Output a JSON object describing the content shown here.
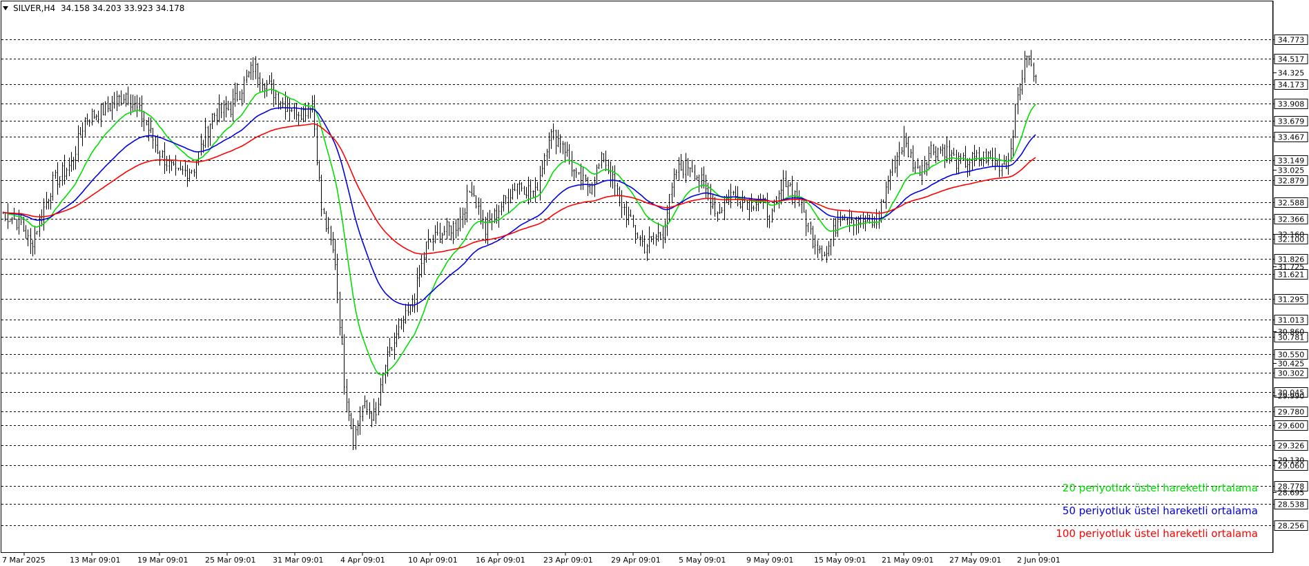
{
  "chart_data": {
    "type": "candlestick",
    "symbol_line": {
      "symbol": "SILVER,H4",
      "values": "34.158 34.203 33.923 34.178"
    },
    "ylim": [
      28.05,
      34.92
    ],
    "tagged_levels": [
      34.773,
      34.517,
      34.173,
      33.908,
      33.679,
      33.467,
      33.149,
      32.879,
      32.588,
      32.366,
      32.1,
      31.826,
      31.621,
      31.295,
      31.013,
      30.781,
      30.55,
      30.302,
      30.045,
      29.78,
      29.6,
      29.326,
      29.06,
      28.778,
      28.538,
      28.256
    ],
    "scale_ticks": [
      34.325,
      33.025,
      32.16,
      31.725,
      30.86,
      30.425,
      29.99,
      29.13,
      28.695
    ],
    "x_labels": [
      "7 Mar 2025",
      "13 Mar 09:01",
      "19 Mar 09:01",
      "25 Mar 09:01",
      "31 Mar 09:01",
      "4 Apr 09:01",
      "10 Apr 09:01",
      "16 Apr 09:01",
      "23 Apr 09:01",
      "29 Apr 09:01",
      "5 May 09:01",
      "9 May 09:01",
      "15 May 09:01",
      "21 May 09:01",
      "27 May 09:01",
      "2 Jun 09:01"
    ],
    "series": [
      {
        "name": "20 periyotluk üstel hareketli ortalama",
        "color": "#00e000",
        "period": 20
      },
      {
        "name": "50 periyotluk üstel hareketli ortalama",
        "color": "#0000e0",
        "period": 50
      },
      {
        "name": "100 periyotluk üstel hareketli ortalama",
        "color": "#ff0000",
        "period": 100
      }
    ],
    "price_path": [
      {
        "t": 0,
        "p": 32.45
      },
      {
        "t": 8,
        "p": 32.3
      },
      {
        "t": 12,
        "p": 32.0
      },
      {
        "t": 22,
        "p": 32.85
      },
      {
        "t": 30,
        "p": 33.1
      },
      {
        "t": 36,
        "p": 33.7
      },
      {
        "t": 46,
        "p": 33.85
      },
      {
        "t": 54,
        "p": 34.05
      },
      {
        "t": 62,
        "p": 33.7
      },
      {
        "t": 68,
        "p": 33.3
      },
      {
        "t": 76,
        "p": 32.95
      },
      {
        "t": 84,
        "p": 33.05
      },
      {
        "t": 92,
        "p": 33.75
      },
      {
        "t": 100,
        "p": 33.85
      },
      {
        "t": 110,
        "p": 34.4
      },
      {
        "t": 118,
        "p": 34.1
      },
      {
        "t": 124,
        "p": 33.9
      },
      {
        "t": 132,
        "p": 33.8
      },
      {
        "t": 136,
        "p": 33.95
      },
      {
        "t": 140,
        "p": 32.5
      },
      {
        "t": 146,
        "p": 31.8
      },
      {
        "t": 150,
        "p": 30.2
      },
      {
        "t": 154,
        "p": 29.4
      },
      {
        "t": 158,
        "p": 29.85
      },
      {
        "t": 164,
        "p": 29.7
      },
      {
        "t": 168,
        "p": 30.4
      },
      {
        "t": 174,
        "p": 30.85
      },
      {
        "t": 180,
        "p": 31.2
      },
      {
        "t": 186,
        "p": 32.0
      },
      {
        "t": 194,
        "p": 32.2
      },
      {
        "t": 200,
        "p": 32.3
      },
      {
        "t": 206,
        "p": 32.8
      },
      {
        "t": 212,
        "p": 32.2
      },
      {
        "t": 218,
        "p": 32.5
      },
      {
        "t": 226,
        "p": 32.85
      },
      {
        "t": 234,
        "p": 32.7
      },
      {
        "t": 240,
        "p": 33.5
      },
      {
        "t": 246,
        "p": 33.4
      },
      {
        "t": 252,
        "p": 32.9
      },
      {
        "t": 258,
        "p": 32.8
      },
      {
        "t": 264,
        "p": 33.2
      },
      {
        "t": 270,
        "p": 32.7
      },
      {
        "t": 276,
        "p": 32.3
      },
      {
        "t": 282,
        "p": 32.0
      },
      {
        "t": 290,
        "p": 32.2
      },
      {
        "t": 296,
        "p": 33.0
      },
      {
        "t": 302,
        "p": 33.1
      },
      {
        "t": 308,
        "p": 32.8
      },
      {
        "t": 314,
        "p": 32.45
      },
      {
        "t": 320,
        "p": 32.7
      },
      {
        "t": 326,
        "p": 32.6
      },
      {
        "t": 332,
        "p": 32.6
      },
      {
        "t": 338,
        "p": 32.4
      },
      {
        "t": 344,
        "p": 32.9
      },
      {
        "t": 350,
        "p": 32.6
      },
      {
        "t": 356,
        "p": 32.1
      },
      {
        "t": 362,
        "p": 31.9
      },
      {
        "t": 368,
        "p": 32.45
      },
      {
        "t": 376,
        "p": 32.35
      },
      {
        "t": 384,
        "p": 32.3
      },
      {
        "t": 390,
        "p": 33.0
      },
      {
        "t": 396,
        "p": 33.4
      },
      {
        "t": 402,
        "p": 33.0
      },
      {
        "t": 408,
        "p": 33.3
      },
      {
        "t": 414,
        "p": 33.3
      },
      {
        "t": 420,
        "p": 33.1
      },
      {
        "t": 426,
        "p": 33.15
      },
      {
        "t": 432,
        "p": 33.2
      },
      {
        "t": 438,
        "p": 33.1
      },
      {
        "t": 442,
        "p": 33.15
      },
      {
        "t": 446,
        "p": 34.0
      },
      {
        "t": 450,
        "p": 34.6
      },
      {
        "t": 454,
        "p": 34.2
      }
    ]
  },
  "legend": {
    "ema20": "20 periyotluk üstel hareketli ortalama",
    "ema50": "50 periyotluk üstel hareketli ortalama",
    "ema100": "100 periyotluk üstel hareketli ortalama"
  }
}
